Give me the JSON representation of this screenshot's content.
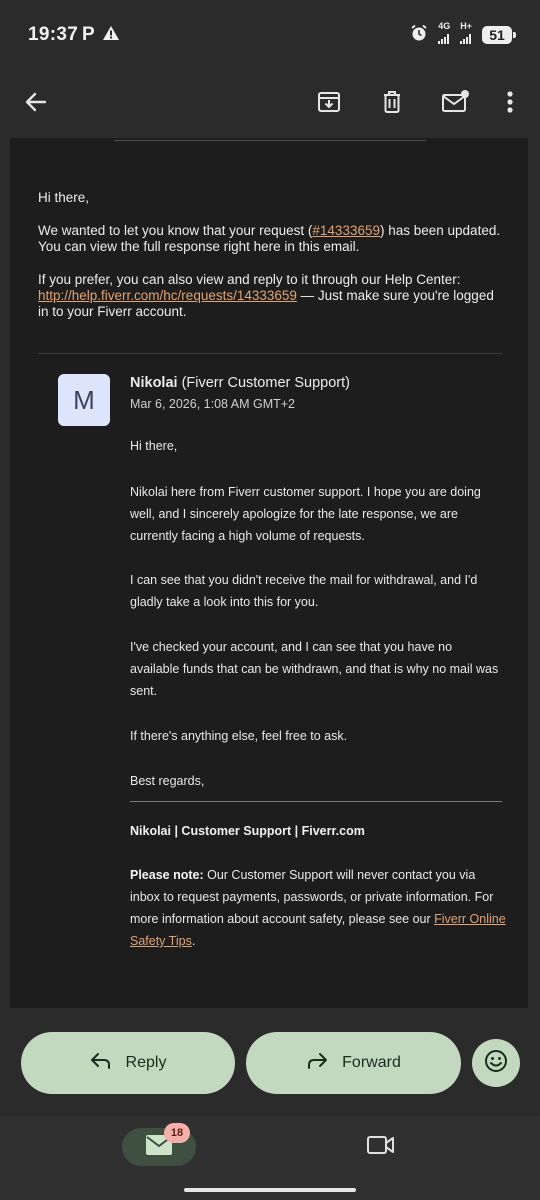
{
  "status_bar": {
    "time": "19:37",
    "p_label": "P",
    "net1": "4G",
    "net2": "H+",
    "battery": "51"
  },
  "top_bar": {
    "icons": [
      "back-arrow-icon",
      "archive-icon",
      "delete-icon",
      "mark-unread-icon",
      "more-icon"
    ]
  },
  "intro": {
    "greeting": "Hi there,",
    "line1_pre": "We wanted to let you know that your request (",
    "request_id": "#14333659",
    "line1_post": ") has been updated. You can view the full response right here in this email.",
    "line2": "If you prefer, you can also view and reply to it through our Help Center:",
    "help_url": "http://help.fiverr.com/hc/requests/14333659",
    "line2_post": " — Just make sure you're logged in to your Fiverr account."
  },
  "message": {
    "avatar_letter": "M",
    "sender_name": "Nikolai",
    "sender_org": " (Fiverr Customer Support)",
    "date": "Mar 6, 2026, 1:08 AM GMT+2",
    "greeting": "Hi there,",
    "p1": "Nikolai here from Fiverr customer support. I hope you are doing well, and I sincerely apologize for the late response, we are currently facing a high volume of requests.",
    "p2": "I can see that you didn't receive the mail for withdrawal, and I'd gladly take a look into this for you.",
    "p3": "I've checked your account, and I can see that you have no available funds that can be withdrawn, and that is why no mail was sent.",
    "p4": "If there's anything else, feel free to ask.",
    "closing": "Best regards,",
    "signature": "Nikolai | Customer Support | Fiverr.com",
    "note_label": "Please note:",
    "note_text": " Our Customer Support will never contact you via inbox to request payments, passwords, or private information. For more information about account safety, please see our ",
    "note_link": "Fiverr Online Safety Tips",
    "note_end": "."
  },
  "actions": {
    "reply": "Reply",
    "forward": "Forward"
  },
  "bottom_nav": {
    "mail_badge": "18"
  },
  "colors": {
    "accent_link": "#e0a473",
    "button_bg": "#c3d9bf",
    "card_bg": "#1d1d1d",
    "chrome_bg": "#2b2b2b"
  }
}
